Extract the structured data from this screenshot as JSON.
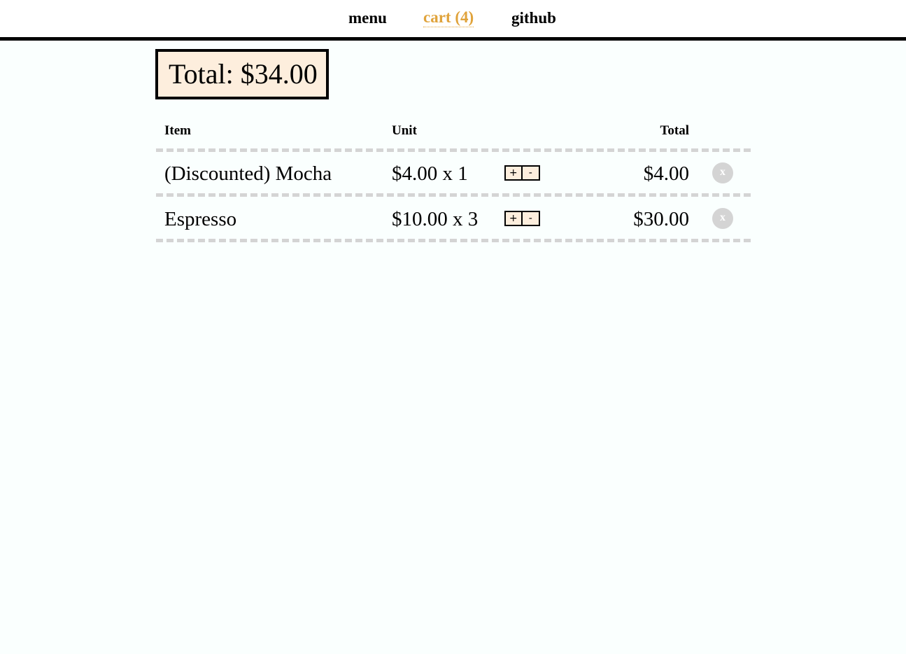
{
  "nav": {
    "menu_label": "menu",
    "cart_label": "cart (4)",
    "github_label": "github",
    "accent_color": "#e0a33b"
  },
  "total": {
    "label": "Total: $34.00"
  },
  "table": {
    "headers": {
      "item": "Item",
      "unit": "Unit",
      "total": "Total"
    },
    "rows": [
      {
        "name": "(Discounted) Mocha",
        "unit": "$4.00 x 1",
        "plus": "+",
        "minus": "-",
        "total": "$4.00",
        "remove": "x"
      },
      {
        "name": "Espresso",
        "unit": "$10.00 x 3",
        "plus": "+",
        "minus": "-",
        "total": "$30.00",
        "remove": "x"
      }
    ]
  }
}
